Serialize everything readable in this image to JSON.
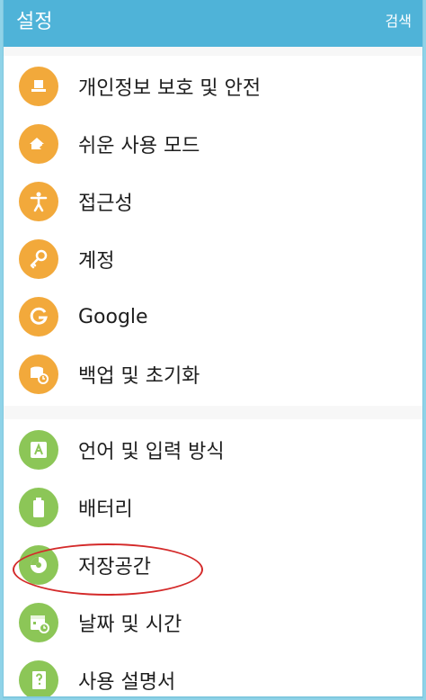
{
  "appbar": {
    "title": "설정",
    "search_label": "검색"
  },
  "colors": {
    "appbar": "#4fb3d8",
    "orange_icon": "#f2a93b",
    "green_icon": "#8cc657",
    "highlight": "#d42a2a"
  },
  "section1": {
    "items": [
      {
        "label": "개인정보 보호 및 안전",
        "icon": "alert-icon"
      },
      {
        "label": "쉬운 사용 모드",
        "icon": "easy-mode-icon"
      },
      {
        "label": "접근성",
        "icon": "accessibility-icon"
      },
      {
        "label": "계정",
        "icon": "key-icon"
      },
      {
        "label": "Google",
        "icon": "google-icon"
      },
      {
        "label": "백업 및 초기화",
        "icon": "backup-icon"
      }
    ]
  },
  "section2": {
    "items": [
      {
        "label": "언어 및 입력 방식",
        "icon": "language-icon"
      },
      {
        "label": "배터리",
        "icon": "battery-icon"
      },
      {
        "label": "저장공간",
        "icon": "storage-icon"
      },
      {
        "label": "날짜 및 시간",
        "icon": "calendar-icon"
      },
      {
        "label": "사용 설명서",
        "icon": "manual-icon"
      }
    ]
  }
}
